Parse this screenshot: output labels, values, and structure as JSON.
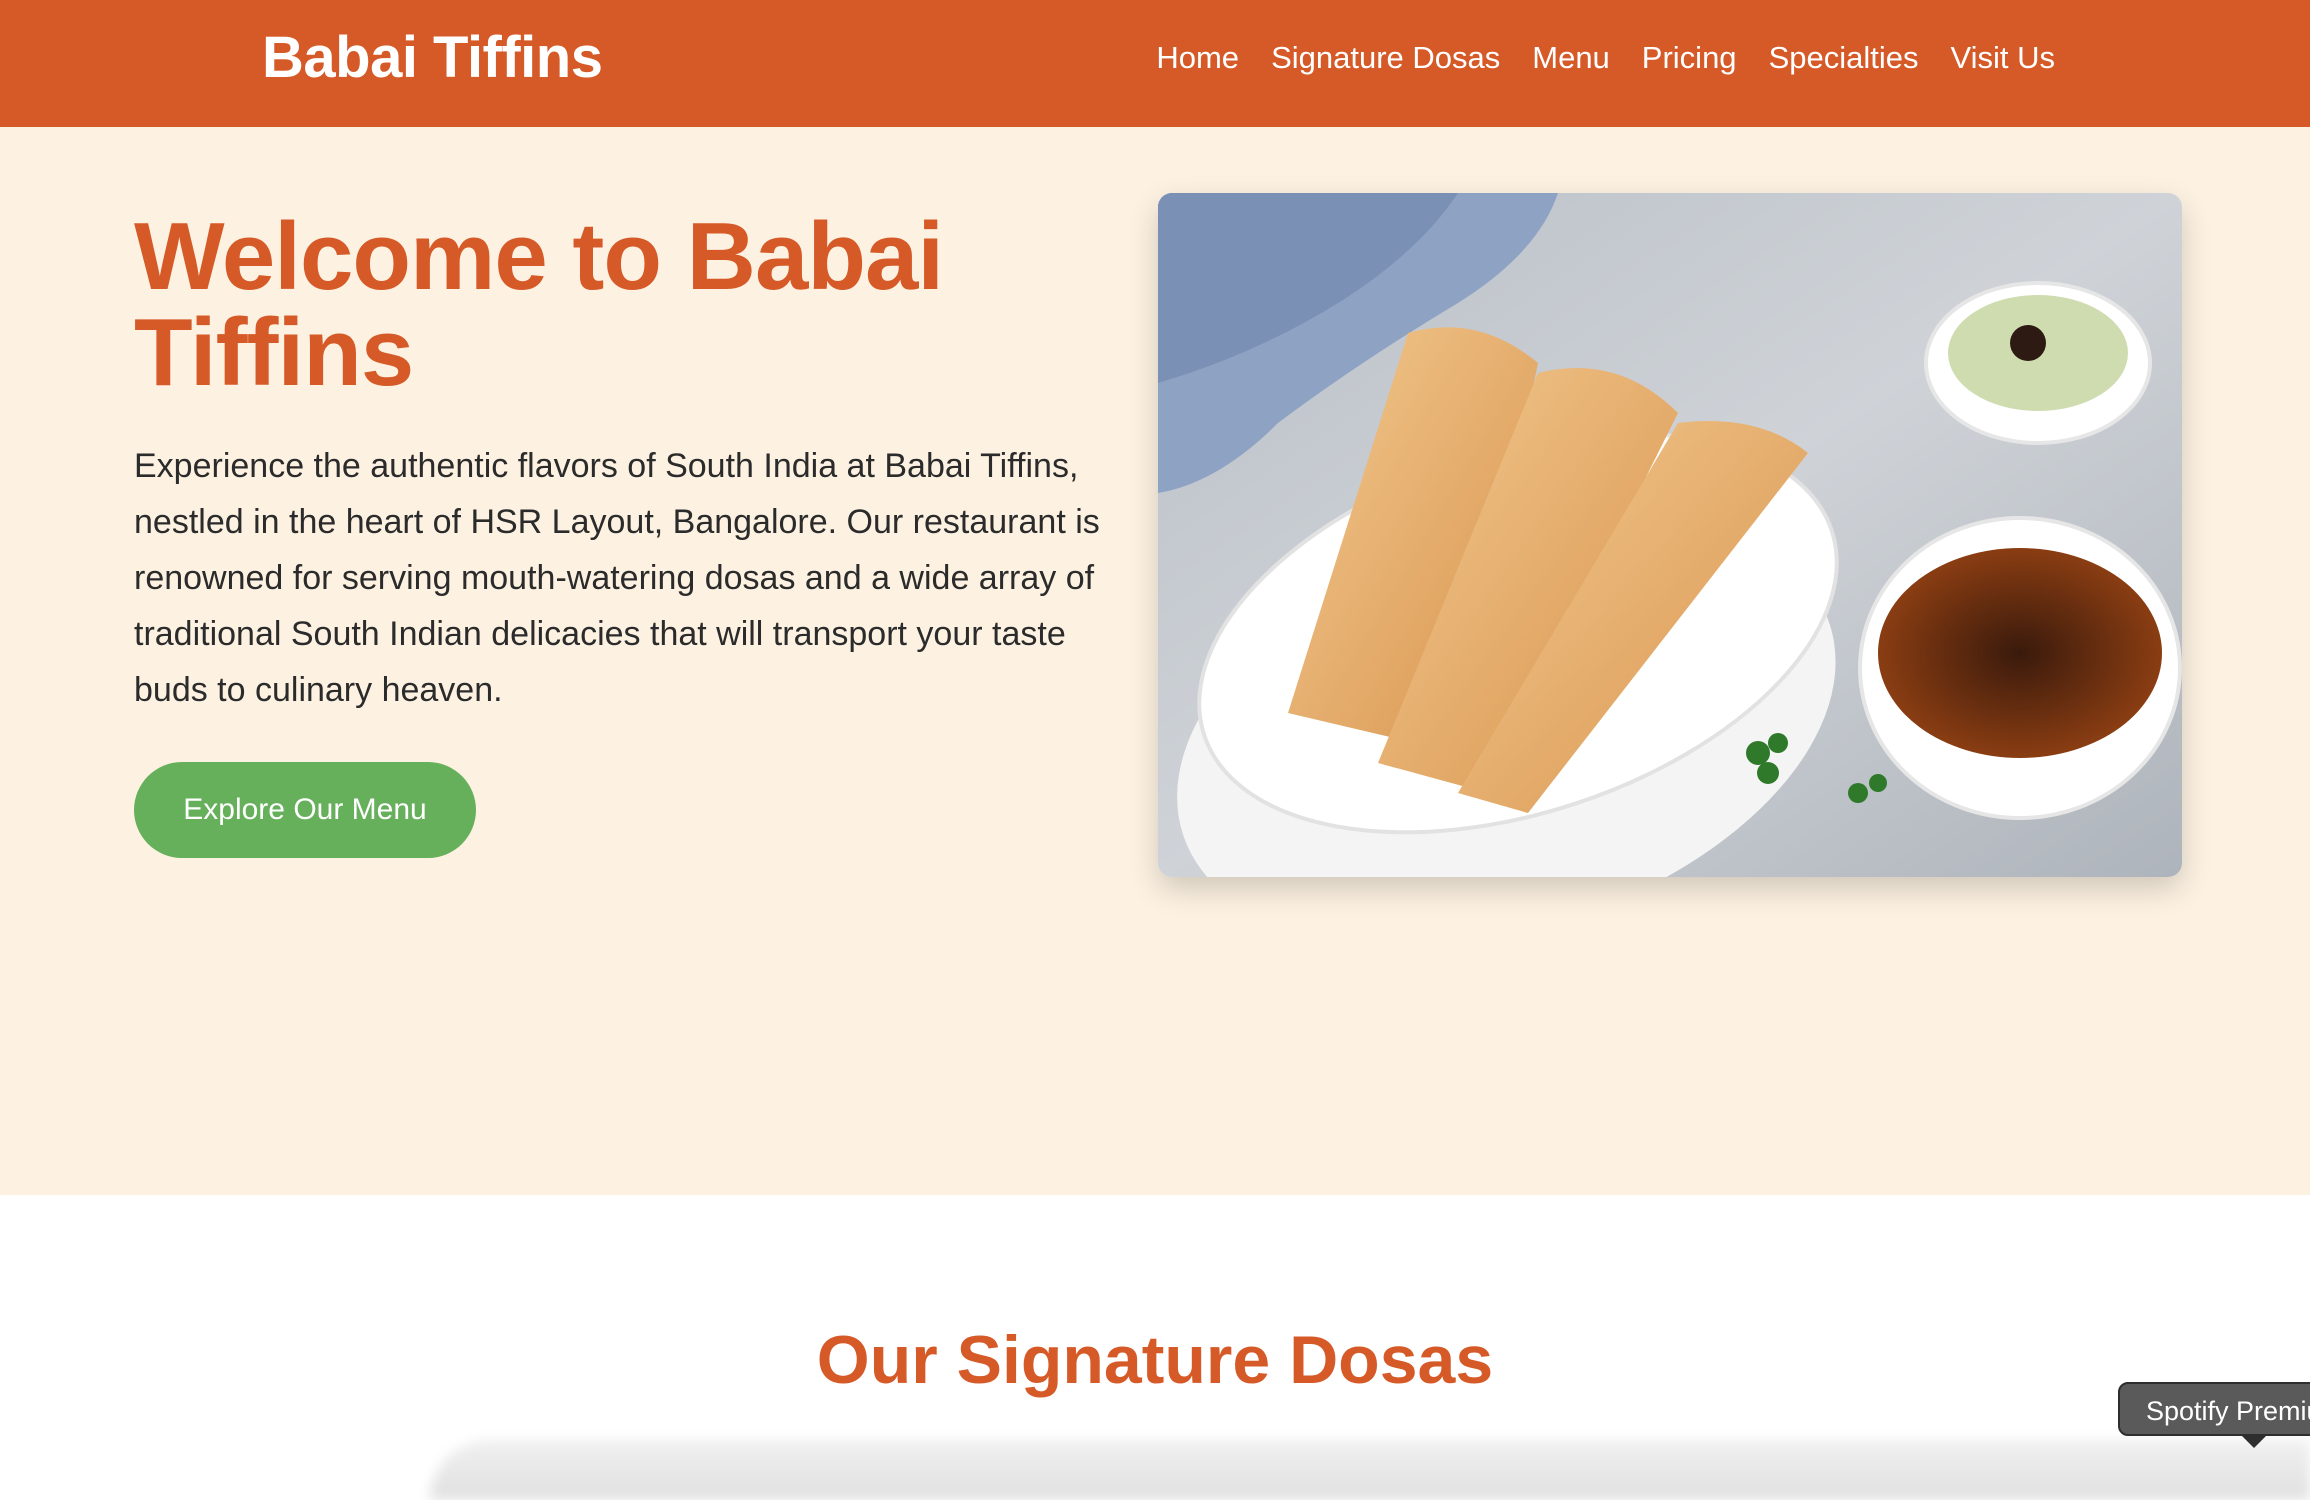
{
  "brand": {
    "name": "Babai Tiffins"
  },
  "nav": {
    "items": [
      "Home",
      "Signature Dosas",
      "Menu",
      "Pricing",
      "Specialties",
      "Visit Us"
    ]
  },
  "hero": {
    "title": "Welcome to Babai Tiffins",
    "description": "Experience the authentic flavors of South India at Babai Tiffins, nestled in the heart of HSR Layout, Bangalore. Our restaurant is renowned for serving mouth-watering dosas and a wide array of traditional South Indian delicacies that will transport your taste buds to culinary heaven.",
    "cta_label": "Explore Our Menu",
    "image_icon": "dosa-platter-image"
  },
  "signature": {
    "title": "Our Signature Dosas"
  },
  "tooltip": {
    "text": "Spotify Premium"
  },
  "colors": {
    "primary": "#D65A28",
    "hero_bg": "#FDF2E2",
    "cta": "#66B05C",
    "text": "#2b2b2b"
  }
}
